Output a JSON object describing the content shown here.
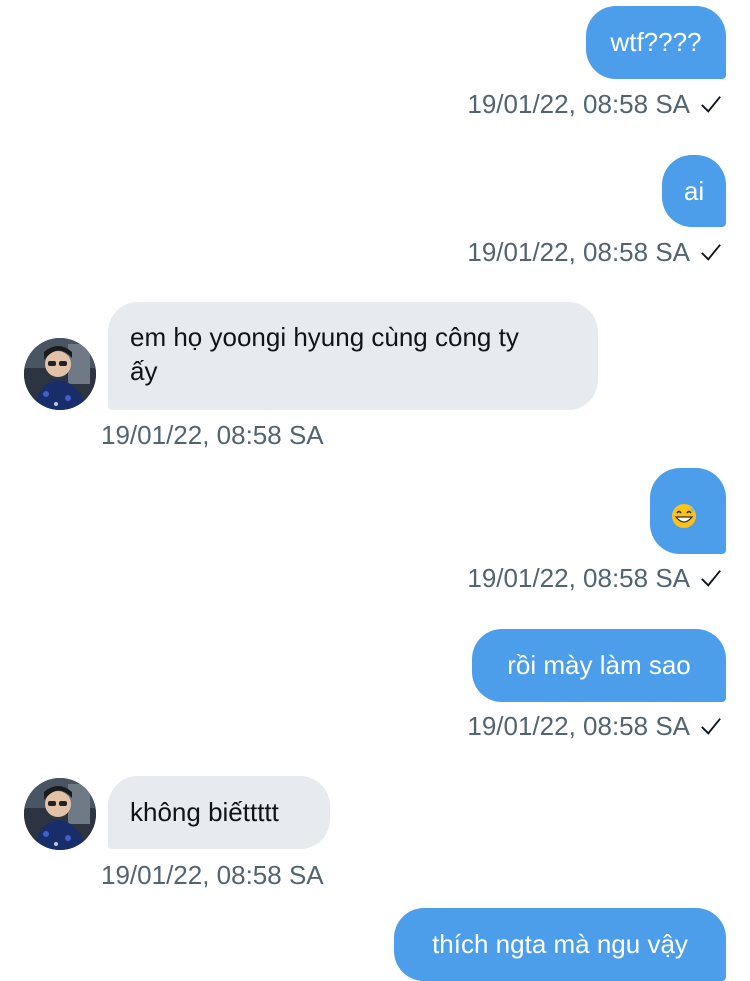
{
  "messages": [
    {
      "direction": "outgoing",
      "text": "wtf????",
      "timestamp": "19/01/22, 08:58 SA",
      "status_icon": "check-icon"
    },
    {
      "direction": "outgoing",
      "text": "ai",
      "timestamp": "19/01/22, 08:58 SA",
      "status_icon": "check-icon"
    },
    {
      "direction": "incoming",
      "text_line1": "em họ yoongi hyung cùng công ty",
      "text_line2": "ấy",
      "timestamp": "19/01/22, 08:58 SA",
      "avatar_icon": "user-avatar"
    },
    {
      "direction": "outgoing",
      "text": "",
      "emoji": "grinning-face-with-sweat-emoji",
      "timestamp": "19/01/22, 08:58 SA",
      "status_icon": "check-icon"
    },
    {
      "direction": "outgoing",
      "text": "rồi mày làm sao",
      "timestamp": "19/01/22, 08:58 SA",
      "status_icon": "check-icon"
    },
    {
      "direction": "incoming",
      "text": "không biếttttt",
      "timestamp": "19/01/22, 08:58 SA",
      "avatar_icon": "user-avatar"
    },
    {
      "direction": "outgoing",
      "text": "thích ngta mà ngu vậy",
      "timestamp": "",
      "status_icon": ""
    }
  ],
  "colors": {
    "outgoing_bubble": "#4c9eeb",
    "incoming_bubble": "#e7eaef",
    "timestamp_text": "#536471"
  }
}
